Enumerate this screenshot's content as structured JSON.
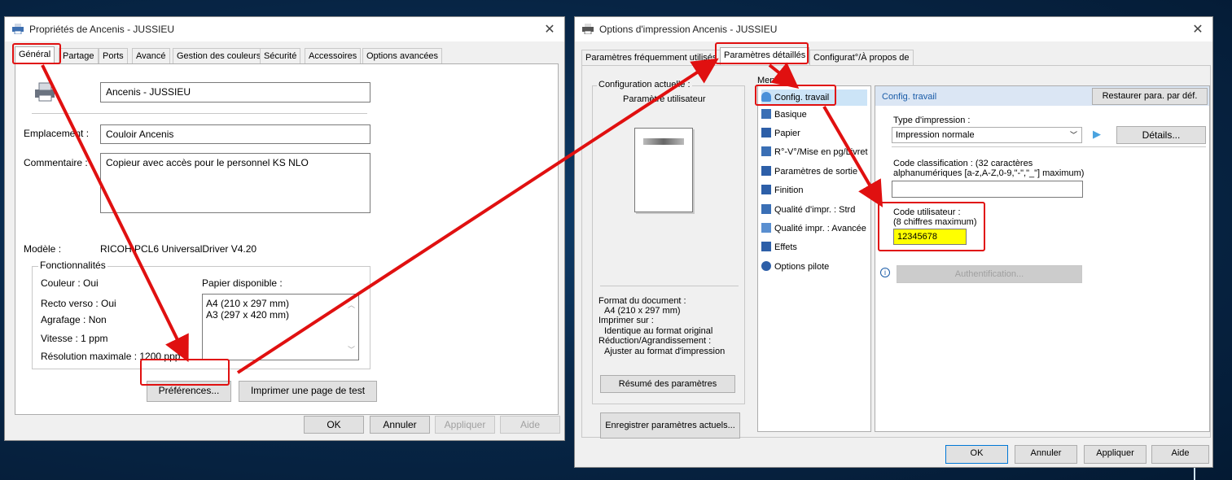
{
  "left_window": {
    "title": "Propriétés de Ancenis - JUSSIEU",
    "tabs": [
      "Général",
      "Partage",
      "Ports",
      "Avancé",
      "Gestion des couleurs",
      "Sécurité",
      "Accessoires",
      "Options avancées"
    ],
    "printer_name": "Ancenis - JUSSIEU",
    "location_label": "Emplacement :",
    "location_value": "Couloir Ancenis",
    "comment_label": "Commentaire :",
    "comment_value": "Copieur avec accès pour le personnel KS NLO",
    "model_label": "Modèle :",
    "model_value": "RICOH PCL6 UniversalDriver V4.20",
    "features_label": "Fonctionnalités",
    "color": "Couleur : Oui",
    "duplex": "Recto verso : Oui",
    "staple": "Agrafage : Non",
    "speed": "Vitesse : 1 ppm",
    "resolution": "Résolution maximale : 1200 ppp",
    "paper_label": "Papier disponible :",
    "paper_items": [
      "A4 (210 x 297 mm)",
      "A3 (297 x 420 mm)"
    ],
    "preferences_button": "Préférences...",
    "test_page_button": "Imprimer une page de test",
    "ok": "OK",
    "cancel": "Annuler",
    "apply": "Appliquer",
    "help": "Aide"
  },
  "right_window": {
    "title": "Options d'impression Ancenis - JUSSIEU",
    "tabs": [
      "Paramètres fréquemment utilisés",
      "Paramètres détaillés",
      "Configurat°/À propos de"
    ],
    "current_config_label": "Configuration actuelle :",
    "user_settings": "Paramètre utilisateur",
    "doc_format_label": "Format du document :",
    "doc_format_value": "A4 (210 x 297 mm)",
    "print_on_label": "Imprimer sur :",
    "print_on_value": "Identique au format original",
    "reduce_label": "Réduction/Agrandissement :",
    "reduce_value": "Ajuster au format d'impression",
    "summary_button": "Résumé des paramètres",
    "save_button": "Enregistrer paramètres actuels...",
    "menu_label": "Menu :",
    "menu_items": [
      "Config. travail",
      "Basique",
      "Papier",
      "R°-V°/Mise en pg/Livret",
      "Paramètres de sortie",
      "Finition",
      "Qualité d'impr. : Strd",
      "Qualité impr. : Avancée",
      "Effets",
      "Options pilote"
    ],
    "panel_title": "Config. travail",
    "restore_button": "Restaurer para. par déf.",
    "print_type_label": "Type d'impression :",
    "print_type_value": "Impression normale",
    "details_button": "Détails...",
    "classification_label": "Code classification : (32 caractères",
    "classification_label2": "alphanumériques [a-z,A-Z,0-9,\"-\",\"_\"] maximum)",
    "classification_value": "",
    "user_code_label": "Code utilisateur :",
    "user_code_hint": "(8 chiffres maximum)",
    "user_code_value": "12345678",
    "auth_button": "Authentification...",
    "ok": "OK",
    "cancel": "Annuler",
    "apply": "Appliquer",
    "help": "Aide"
  },
  "colors": {
    "annotation_red": "#e01010",
    "highlight_yellow": "#ffff00",
    "panel_header_blue": "#dbe6f4",
    "desktop_blue": "#0b3a66"
  }
}
